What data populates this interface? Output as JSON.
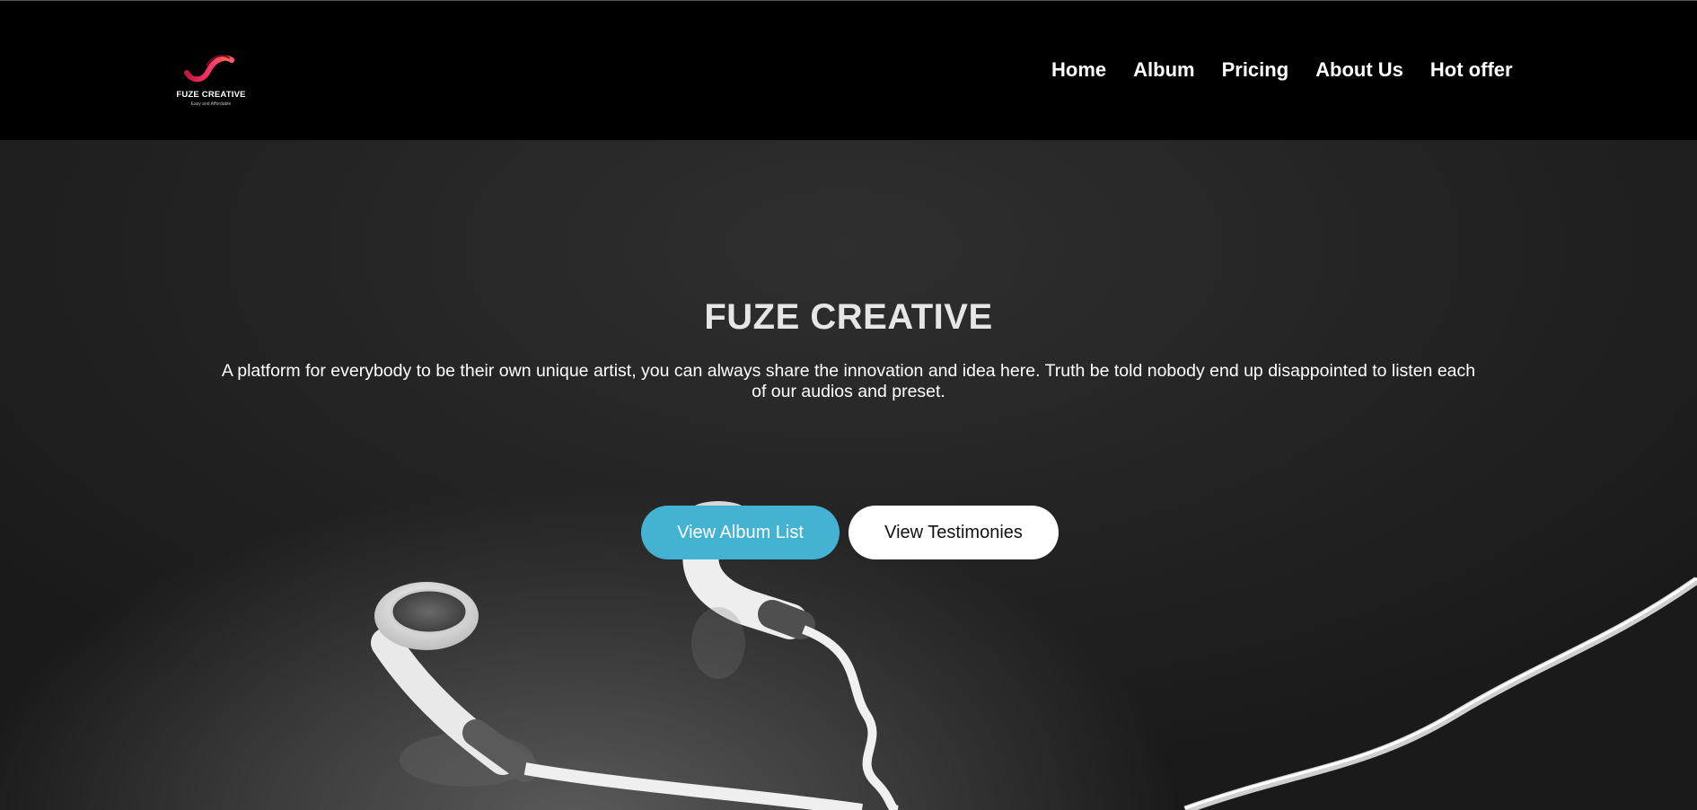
{
  "header": {
    "logo": {
      "brand": "FUZE CREATIVE",
      "tagline": "Easy and Affordable"
    },
    "nav": [
      {
        "label": "Home"
      },
      {
        "label": "Album"
      },
      {
        "label": "Pricing"
      },
      {
        "label": "About Us"
      },
      {
        "label": "Hot offer"
      }
    ]
  },
  "hero": {
    "title": "FUZE CREATIVE",
    "description": "A platform for everybody to be their own unique artist, you can always share the innovation and idea here. Truth be told nobody end up disappointed to listen each of our audios and preset.",
    "primary_button": "View Album List",
    "secondary_button": "View Testimonies"
  },
  "colors": {
    "header_bg": "#000000",
    "primary_button": "#44b3d3",
    "secondary_button": "#ffffff",
    "logo_accent": "#e8245c"
  },
  "icons": {
    "logo": "fuze-creative-swirl-logo",
    "hero_background": "white-earphones-photo"
  }
}
